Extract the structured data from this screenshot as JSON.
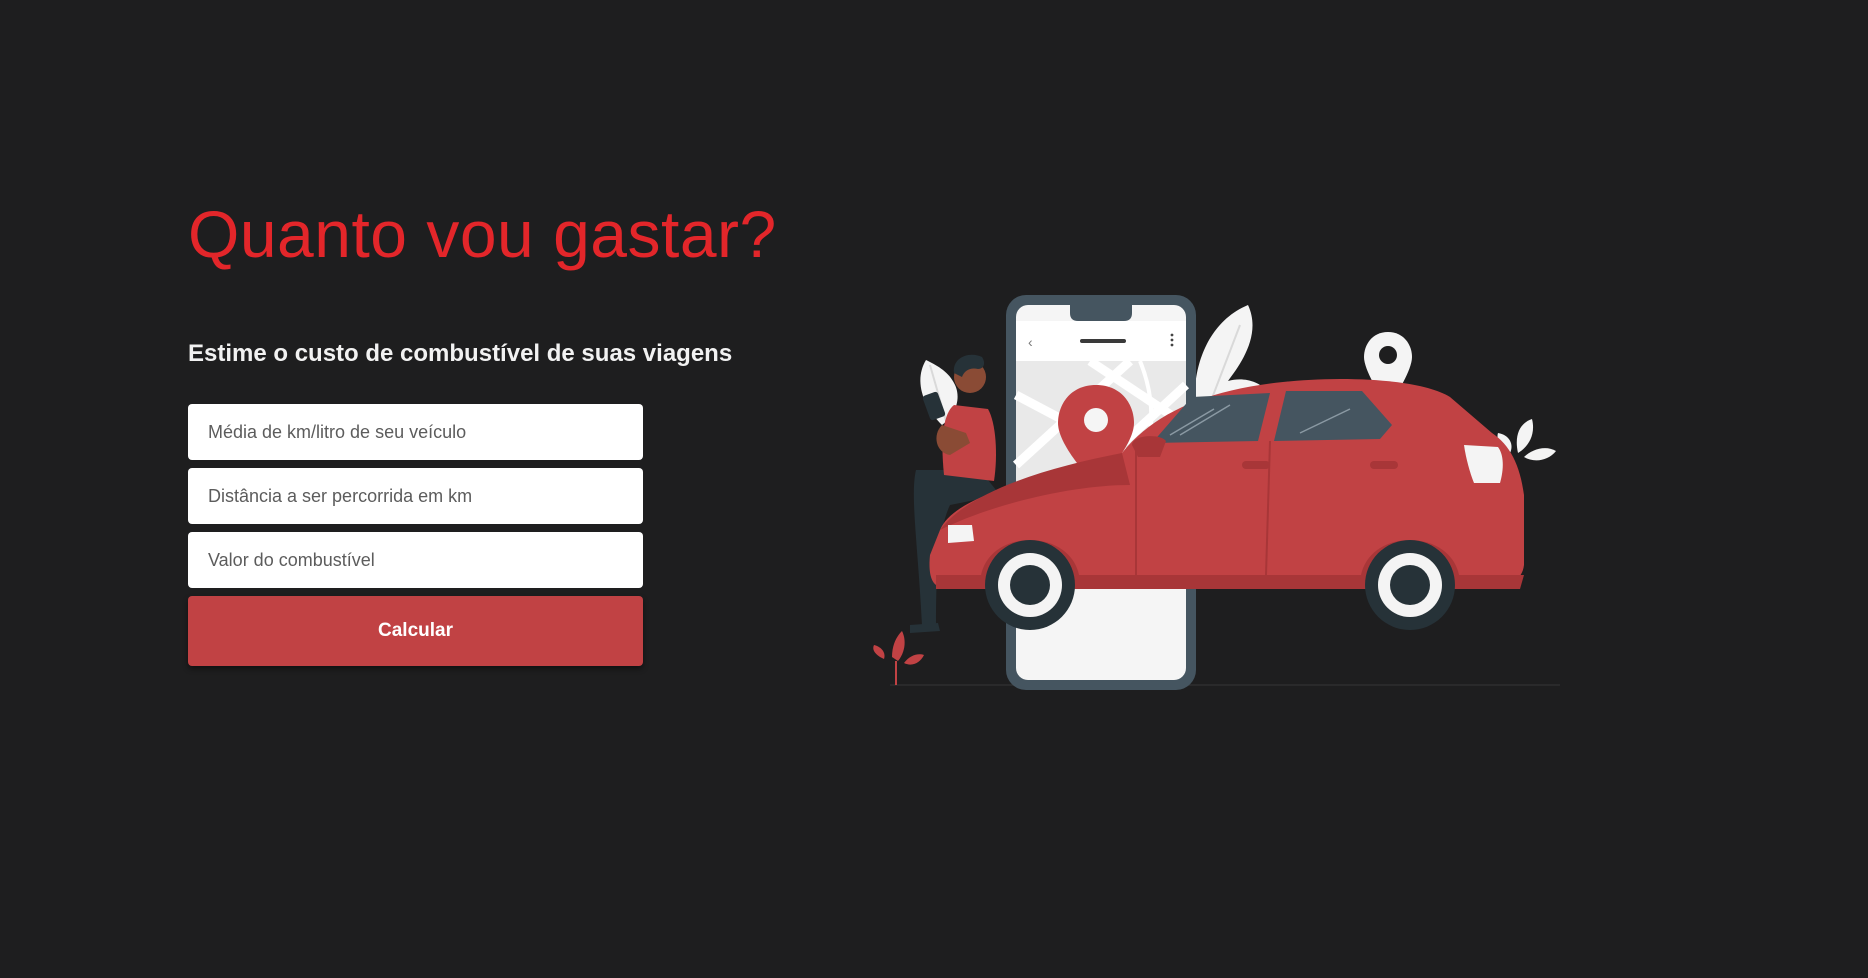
{
  "hero": {
    "title": "Quanto vou gastar?",
    "subtitle": "Estime o custo de combustível de suas viagens"
  },
  "form": {
    "consumption_placeholder": "Média de km/litro de seu veículo",
    "distance_placeholder": "Distância a ser percorrida em km",
    "fuel_price_placeholder": "Valor do combustível",
    "submit_label": "Calcular"
  },
  "colors": {
    "background": "#1e1e1f",
    "title": "#e3262a",
    "accent": "#c14244",
    "car": "#c14244",
    "phone_frame": "#455560"
  },
  "illustration": {
    "icons": [
      "smartphone-icon",
      "map-pin-icon",
      "car-icon",
      "person-icon",
      "leaf-icon"
    ]
  }
}
